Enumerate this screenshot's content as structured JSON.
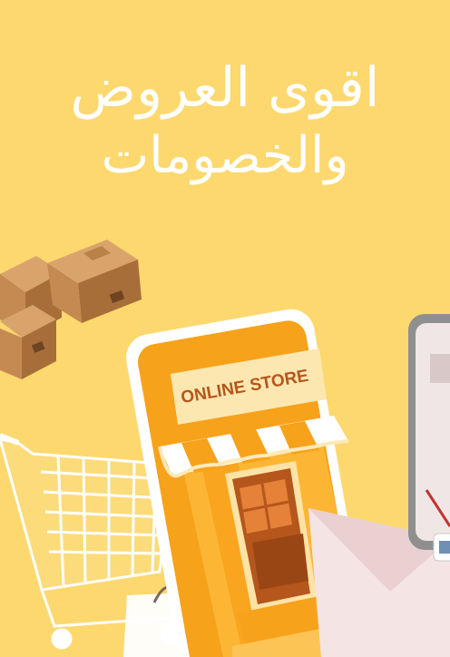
{
  "banner": {
    "headline_line1": "اقوى العروض",
    "headline_line2": "والخصومات",
    "store_sign": "ONLINE STORE"
  },
  "colors": {
    "background": "#fcd86f",
    "store_orange": "#f7a21b",
    "store_light": "#fde7b0",
    "door_brown": "#b5561c",
    "box_brown": "#c98d55",
    "text": "#ffffff"
  }
}
